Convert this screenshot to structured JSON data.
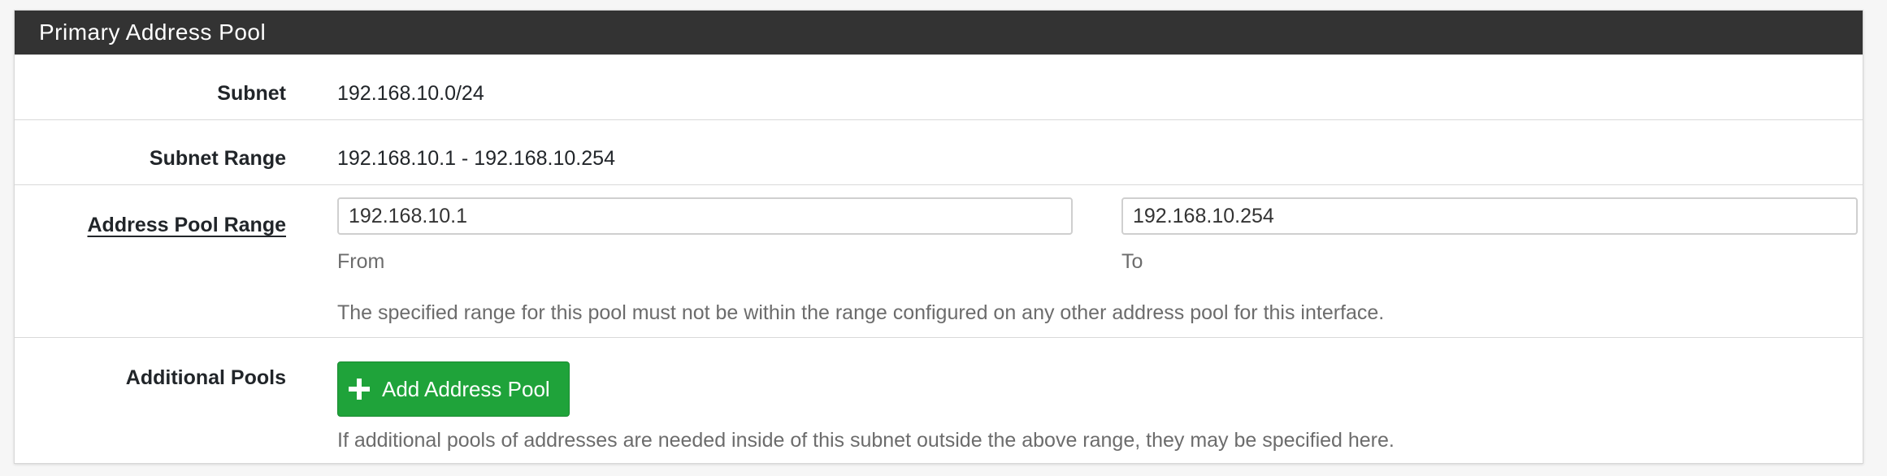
{
  "panel": {
    "title": "Primary Address Pool"
  },
  "subnet": {
    "label": "Subnet",
    "value": "192.168.10.0/24"
  },
  "subnet_range": {
    "label": "Subnet Range",
    "value": "192.168.10.1 - 192.168.10.254"
  },
  "address_pool_range": {
    "label": "Address Pool Range",
    "from_value": "192.168.10.1",
    "to_value": "192.168.10.254",
    "from_label": "From",
    "to_label": "To",
    "help": "The specified range for this pool must not be within the range configured on any other address pool for this interface."
  },
  "additional_pools": {
    "label": "Additional Pools",
    "button_label": "Add Address Pool",
    "button_icon": "plus-icon",
    "help": "If additional pools of addresses are needed inside of this subnet outside the above range, they may be specified here."
  },
  "colors": {
    "heading_bg": "#333333",
    "button_bg": "#1fa33a",
    "help_text": "#6c6c6c"
  }
}
